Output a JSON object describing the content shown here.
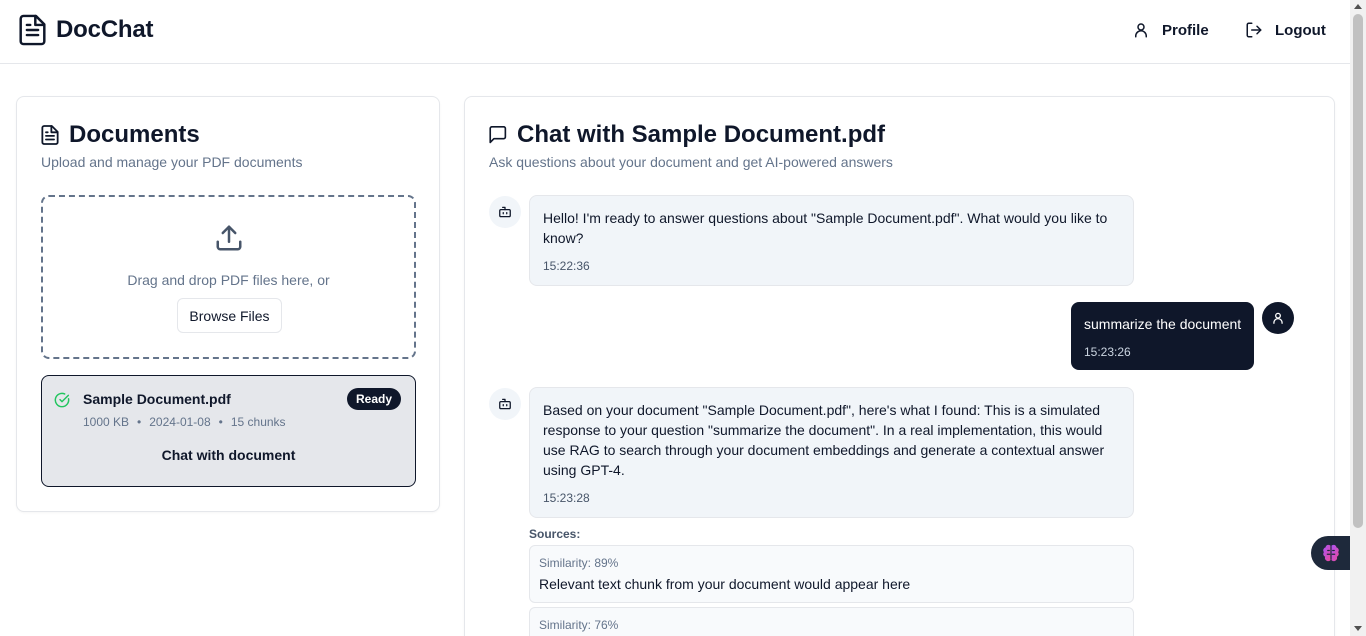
{
  "header": {
    "brand": "DocChat",
    "nav": {
      "profile": "Profile",
      "logout": "Logout"
    }
  },
  "documents": {
    "title": "Documents",
    "subtitle": "Upload and manage your PDF documents",
    "dropzone": {
      "text": "Drag and drop PDF files here, or",
      "browse_label": "Browse Files"
    },
    "items": [
      {
        "name": "Sample Document.pdf",
        "status": "Ready",
        "size": "1000 KB",
        "date": "2024-01-08",
        "chunks": "15 chunks",
        "action": "Chat with document"
      }
    ]
  },
  "chat": {
    "title": "Chat with Sample Document.pdf",
    "subtitle": "Ask questions about your document and get AI-powered answers",
    "messages": [
      {
        "role": "assistant",
        "lines": [
          "Hello! I'm ready to answer questions about \"Sample Document.pdf\". What would you like to",
          "know?"
        ],
        "time": "15:22:36"
      },
      {
        "role": "user",
        "lines": [
          "summarize the document"
        ],
        "time": "15:23:26"
      },
      {
        "role": "assistant",
        "lines": [
          "Based on your document \"Sample Document.pdf\", here's what I found: This is a simulated",
          "response to your question \"summarize the document\". In a real implementation, this would",
          "use RAG to search through your document embeddings and generate a contextual answer",
          "using GPT-4."
        ],
        "time": "15:23:28"
      }
    ],
    "sources_label": "Sources:",
    "sources": [
      {
        "similarity": "Similarity: 89%",
        "text": "Relevant text chunk from your document would appear here"
      },
      {
        "similarity": "Similarity: 76%",
        "text": ""
      }
    ]
  },
  "icons": {
    "brand": "document-icon",
    "profile": "user-icon",
    "logout": "logout-icon",
    "upload": "upload-icon",
    "ready": "check-circle-icon",
    "bot": "bot-icon",
    "chat": "message-square-icon",
    "floating": "brain-icon"
  },
  "colors": {
    "primary": "#0f172a",
    "muted_text": "#64748b",
    "bubble_bg": "#f1f5f9",
    "success": "#22c55e",
    "selected_item_bg": "#e5e7eb"
  }
}
